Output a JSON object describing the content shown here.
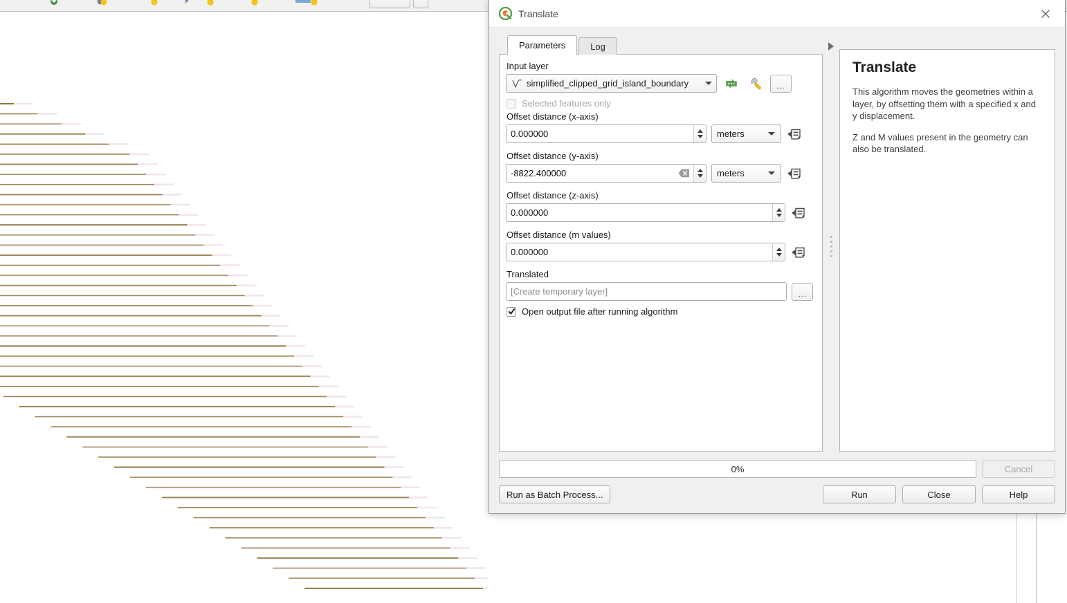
{
  "dialog": {
    "title": "Translate",
    "logo_icon": "qgis-logo-icon",
    "close_icon": "close-icon",
    "tabs": [
      {
        "label": "Parameters",
        "active": true
      },
      {
        "label": "Log",
        "active": false
      }
    ],
    "parameters": {
      "input_layer": {
        "label": "Input layer",
        "value": "simplified_clipped_grid_island_boundary",
        "layer_icon": "vector-line-layer-icon",
        "iterate_icon": "iterate-over-features-icon",
        "advanced_icon": "wrench-icon",
        "browse_label": "..."
      },
      "selected_features_only": {
        "label": "Selected features only",
        "checked": false,
        "enabled": false
      },
      "offset_x": {
        "label": "Offset distance (x-axis)",
        "value": "0.000000",
        "unit": "meters",
        "has_clear": false,
        "override_icon": "data-defined-override-icon"
      },
      "offset_y": {
        "label": "Offset distance (y-axis)",
        "value": "-8822.400000",
        "unit": "meters",
        "has_clear": true,
        "clear_icon": "clear-text-icon",
        "override_icon": "data-defined-override-icon"
      },
      "offset_z": {
        "label": "Offset distance (z-axis)",
        "value": "0.000000",
        "override_icon": "data-defined-override-icon"
      },
      "offset_m": {
        "label": "Offset distance (m values)",
        "value": "0.000000",
        "override_icon": "data-defined-override-icon"
      },
      "output": {
        "label": "Translated",
        "placeholder": "[Create temporary layer]",
        "value": "",
        "browse_label": "..."
      },
      "open_output": {
        "label": "Open output file after running algorithm",
        "checked": true
      }
    },
    "help": {
      "title": "Translate",
      "paragraphs": [
        "This algorithm moves the geometries within a layer, by offsetting them with a specified x and y displacement.",
        "Z and M values present in the geometry can also be translated."
      ],
      "collapse_icon": "collapse-right-icon"
    },
    "footer": {
      "progress_text": "0%",
      "progress_value": 0,
      "cancel_label": "Cancel",
      "cancel_enabled": false,
      "batch_label": "Run as Batch Process...",
      "run_label": "Run",
      "close_label": "Close",
      "help_label": "Help"
    }
  },
  "canvas": {
    "layer_line_color": "#8a7434",
    "layer_halo_color": "#f2e6ea",
    "background_color": "#ffffff"
  },
  "colors": {
    "accent_green": "#5aa050",
    "dialog_bg": "#f0f0f0",
    "panel_bg": "#ffffff",
    "border": "#b4b4b4"
  }
}
